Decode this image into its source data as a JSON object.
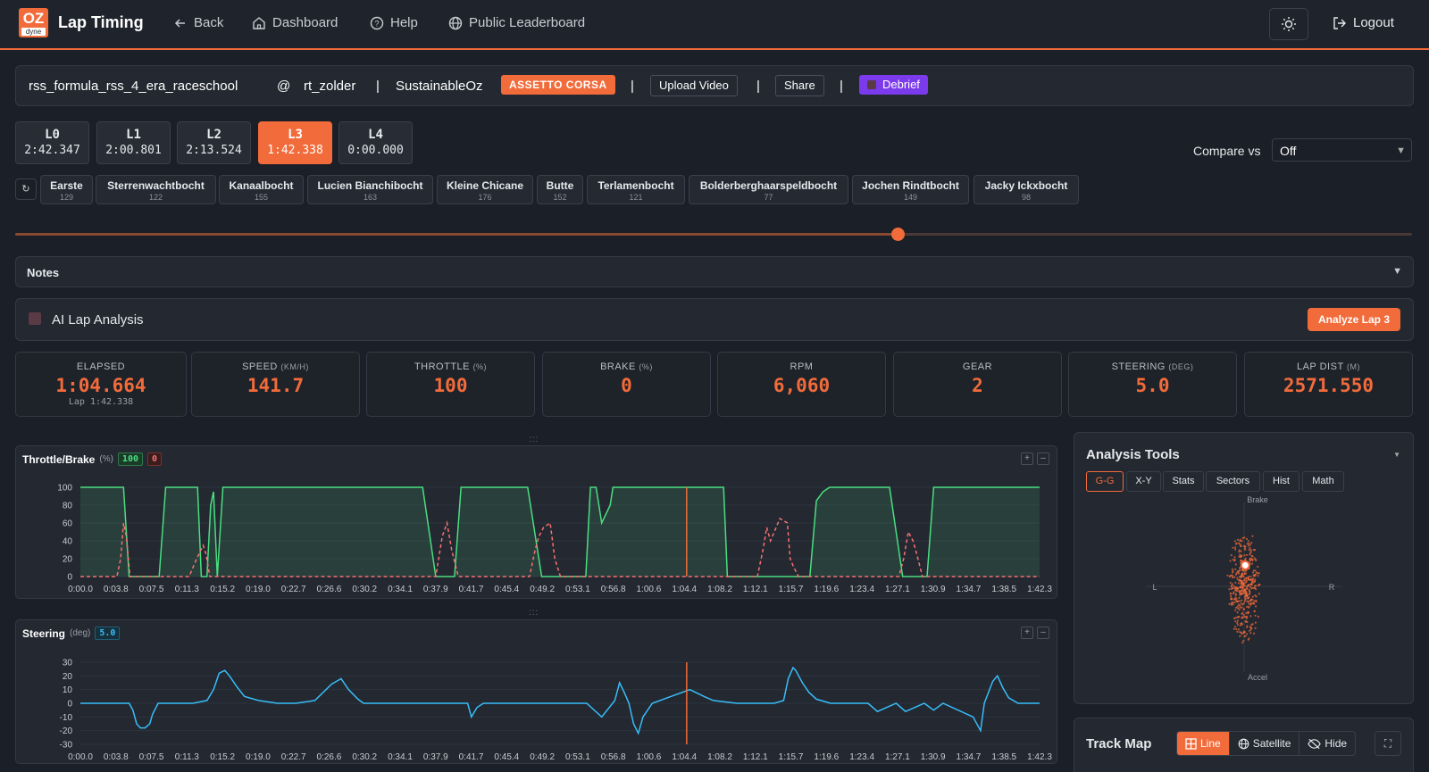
{
  "app": {
    "logo_text": "OZ",
    "logo_sub": "dyne",
    "title": "Lap Timing"
  },
  "nav": {
    "back": "Back",
    "dashboard": "Dashboard",
    "help": "Help",
    "leaderboard": "Public Leaderboard",
    "logout": "Logout"
  },
  "session": {
    "car": "rss_formula_rss_4_era_raceschool",
    "at": "@",
    "track": "rt_zolder",
    "sep": "|",
    "team": "SustainableOz",
    "game": "ASSETTO CORSA",
    "upload": "Upload Video",
    "share": "Share",
    "debrief": "Debrief"
  },
  "laps": [
    {
      "name": "L0",
      "time": "2:42.347"
    },
    {
      "name": "L1",
      "time": "2:00.801"
    },
    {
      "name": "L2",
      "time": "2:13.524"
    },
    {
      "name": "L3",
      "time": "1:42.338",
      "active": true
    },
    {
      "name": "L4",
      "time": "0:00.000"
    }
  ],
  "compare": {
    "label": "Compare vs",
    "value": "Off"
  },
  "corners": [
    {
      "name": "Earste",
      "value": "129"
    },
    {
      "name": "Sterrenwachtbocht",
      "value": "122"
    },
    {
      "name": "Kanaalbocht",
      "value": "155"
    },
    {
      "name": "Lucien Bianchibocht",
      "value": "163"
    },
    {
      "name": "Kleine Chicane",
      "value": "176"
    },
    {
      "name": "Butte",
      "value": "152"
    },
    {
      "name": "Terlamenbocht",
      "value": "121"
    },
    {
      "name": "Bolderberghaarspeldbocht",
      "value": "77"
    },
    {
      "name": "Jochen Rindtbocht",
      "value": "149"
    },
    {
      "name": "Jacky Ickxbocht",
      "value": "98"
    }
  ],
  "playback": {
    "position": 0.632
  },
  "notes": {
    "title": "Notes"
  },
  "ai": {
    "title": "AI Lap Analysis",
    "button": "Analyze Lap 3"
  },
  "metrics": {
    "elapsed": {
      "label": "ELAPSED",
      "value": "1:04.664",
      "sub": "Lap 1:42.338"
    },
    "speed": {
      "label": "SPEED",
      "unit": "(KM/H)",
      "value": "141.7"
    },
    "throttle": {
      "label": "THROTTLE",
      "unit": "(%)",
      "value": "100"
    },
    "brake": {
      "label": "BRAKE",
      "unit": "(%)",
      "value": "0"
    },
    "rpm": {
      "label": "RPM",
      "value": "6,060"
    },
    "gear": {
      "label": "GEAR",
      "value": "2"
    },
    "steering": {
      "label": "STEERING",
      "unit": "(DEG)",
      "value": "5.0"
    },
    "lapdist": {
      "label": "LAP DIST",
      "unit": "(M)",
      "value": "2571.550"
    }
  },
  "grip": ":::",
  "chart_data": [
    {
      "type": "line",
      "title": "Throttle/Brake",
      "unit": "(%)",
      "badges": [
        "100",
        "0"
      ],
      "ylim": [
        0,
        100
      ],
      "yticks": [
        "100",
        "80",
        "60",
        "40",
        "20",
        "0"
      ],
      "xticks": [
        "0:00.0",
        "0:03.8",
        "0:07.5",
        "0:11.3",
        "0:15.2",
        "0:19.0",
        "0:22.7",
        "0:26.6",
        "0:30.2",
        "0:34.1",
        "0:37.9",
        "0:41.7",
        "0:45.4",
        "0:49.2",
        "0:53.1",
        "0:56.8",
        "1:00.6",
        "1:04.4",
        "1:08.2",
        "1:12.1",
        "1:15.7",
        "1:19.6",
        "1:23.4",
        "1:27.1",
        "1:30.9",
        "1:34.7",
        "1:38.5",
        "1:42.3"
      ],
      "xlim": [
        0,
        102.3
      ],
      "cursor": 64.66,
      "series": [
        {
          "color": "#4ade80",
          "x": [
            0,
            1.5,
            2.1,
            3.4,
            3.8,
            4.6,
            5.2,
            6.2,
            7.5,
            7.9,
            8.4,
            9.1,
            10.8,
            11.5,
            11.9,
            12.5,
            12.9,
            13.5,
            13.9,
            14.2,
            14.6,
            15.2,
            17,
            26.6,
            36.5,
            37.9,
            39.4,
            39.9,
            40.6,
            47.7,
            49.2,
            50.1,
            51.3,
            53.9,
            54.4,
            55,
            55.6,
            56.5,
            56.8,
            63,
            68.6,
            69,
            70,
            73.5,
            74.1,
            75.4,
            75.9,
            76.5,
            77.2,
            77.8,
            78.5,
            79.2,
            79.9,
            80.2,
            81.3,
            82.4,
            86.3,
            87.7,
            88.5,
            89.2,
            89.6,
            90.3,
            91,
            93,
            102.3
          ],
          "y": [
            100,
            100,
            100,
            100,
            100,
            100,
            0,
            0,
            0,
            0,
            0,
            100,
            100,
            100,
            100,
            100,
            0,
            0,
            80,
            95,
            0,
            100,
            100,
            100,
            100,
            0,
            0,
            0,
            100,
            100,
            0,
            0,
            0,
            0,
            100,
            100,
            60,
            80,
            100,
            100,
            100,
            0,
            0,
            0,
            0,
            0,
            0,
            0,
            0,
            0,
            85,
            95,
            100,
            100,
            100,
            100,
            100,
            0,
            0,
            0,
            0,
            0,
            100,
            100,
            100
          ]
        },
        {
          "color": "#f87171",
          "dashed": true,
          "x": [
            0,
            3.9,
            4.3,
            4.6,
            4.9,
            5.3,
            8.8,
            9.6,
            10.3,
            11.2,
            11.6,
            12.4,
            13.1,
            13.4,
            13.8,
            37.9,
            38.6,
            39.1,
            39.6,
            40.3,
            47.9,
            48.5,
            48.9,
            49.4,
            50.1,
            50.6,
            51.2,
            72.2,
            72.8,
            73.2,
            73.6,
            74.2,
            74.6,
            75.4,
            75.7,
            76.1,
            76.6,
            87.3,
            87.8,
            88.3,
            88.8,
            89.2,
            89.8,
            102.3
          ],
          "y": [
            0,
            0,
            20,
            60,
            45,
            0,
            0,
            0,
            0,
            0,
            0,
            20,
            35,
            25,
            0,
            0,
            45,
            60,
            30,
            0,
            0,
            30,
            45,
            55,
            60,
            20,
            0,
            0,
            30,
            55,
            40,
            55,
            65,
            60,
            20,
            10,
            0,
            0,
            20,
            50,
            40,
            25,
            0,
            0
          ]
        }
      ]
    },
    {
      "type": "line",
      "title": "Steering",
      "unit": "(deg)",
      "badges": [
        "5.0"
      ],
      "ylim": [
        -30,
        30
      ],
      "yticks": [
        "30",
        "20",
        "10",
        "0",
        "-10",
        "-20",
        "-30"
      ],
      "xticks": [
        "0:00.0",
        "0:03.8",
        "0:07.5",
        "0:11.3",
        "0:15.2",
        "0:19.0",
        "0:22.7",
        "0:26.6",
        "0:30.2",
        "0:34.1",
        "0:37.9",
        "0:41.7",
        "0:45.4",
        "0:49.2",
        "0:53.1",
        "0:56.8",
        "1:00.6",
        "1:04.4",
        "1:08.2",
        "1:12.1",
        "1:15.7",
        "1:19.6",
        "1:23.4",
        "1:27.1",
        "1:30.9",
        "1:34.7",
        "1:38.5",
        "1:42.3"
      ],
      "xlim": [
        0,
        102.3
      ],
      "cursor": 64.66,
      "series": [
        {
          "color": "#38bdf8",
          "x": [
            0,
            2,
            4,
            5.2,
            5.6,
            6,
            6.4,
            6.9,
            7.4,
            7.7,
            8.3,
            9,
            10,
            12,
            13.5,
            14.2,
            14.8,
            15.4,
            15.9,
            16.7,
            17.5,
            19,
            21,
            23,
            25,
            26.8,
            27.8,
            28.6,
            29.6,
            30.2,
            31,
            33,
            36,
            39,
            41.3,
            41.7,
            42.3,
            43,
            43.4,
            44,
            45,
            47,
            51,
            54,
            55.6,
            57,
            57.5,
            58,
            58.5,
            59,
            59.5,
            60,
            61,
            63,
            65,
            66.5,
            67.5,
            70,
            72,
            74,
            75,
            75.5,
            76,
            76.3,
            77,
            77.7,
            78.5,
            80,
            83,
            84,
            85,
            87,
            88,
            90,
            91,
            92,
            95.2,
            96,
            96.4,
            97.3,
            97.8,
            98.4,
            99,
            100,
            102.3
          ],
          "y": [
            0,
            0,
            0,
            0,
            -5,
            -15,
            -18,
            -18,
            -15,
            -8,
            0,
            0,
            0,
            0,
            2,
            10,
            22,
            24,
            20,
            12,
            5,
            2,
            0,
            0,
            2,
            14,
            18,
            10,
            3,
            0,
            0,
            0,
            0,
            0,
            0,
            -10,
            -3,
            0,
            0,
            0,
            0,
            0,
            0,
            0,
            -10,
            2,
            15,
            8,
            0,
            -15,
            -22,
            -10,
            0,
            5,
            10,
            5,
            2,
            0,
            0,
            0,
            2,
            18,
            26,
            24,
            15,
            8,
            3,
            0,
            0,
            0,
            -6,
            0,
            -6,
            0,
            -5,
            0,
            -10,
            -20,
            0,
            16,
            20,
            11,
            4,
            0,
            0
          ]
        }
      ]
    },
    {
      "type": "scatter",
      "title": "G-G",
      "labels": {
        "top": "Brake",
        "bottom": "Accel",
        "left": "L",
        "right": "R"
      },
      "xlim": [
        -3,
        3
      ],
      "ylim": [
        -3,
        3
      ],
      "current": [
        0.1,
        0.85
      ],
      "color": "#f26b3a"
    }
  ],
  "tools": {
    "title": "Analysis Tools",
    "tabs": [
      "G-G",
      "X-Y",
      "Stats",
      "Sectors",
      "Hist",
      "Math"
    ]
  },
  "trackmap": {
    "title": "Track Map",
    "line": "Line",
    "satellite": "Satellite",
    "hide": "Hide"
  },
  "colors": {
    "accent": "#f26b3a",
    "throttle": "#4ade80",
    "brake": "#f87171",
    "steering": "#38bdf8",
    "debrief": "#7c3aed"
  }
}
